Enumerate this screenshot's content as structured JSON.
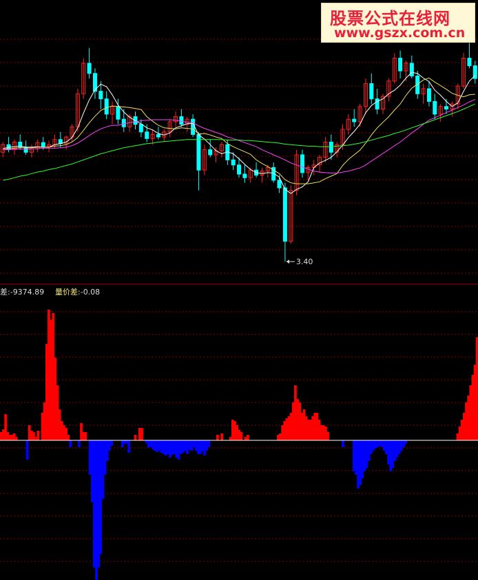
{
  "watermark": {
    "line1": "股票公式在线网",
    "line2": "www.gszx.com.cn"
  },
  "indicator_header": {
    "label1": "差:",
    "value1": "-9374.89",
    "label2": "量价差:",
    "value2": "-0.08"
  },
  "colors": {
    "up": "#ff2020",
    "down": "#00ffff",
    "pos": "#ff0000",
    "neg": "#0000ff",
    "ma5": "#ffffff",
    "ma10": "#f0e060",
    "ma20": "#ff40ff",
    "ma60": "#30ff30",
    "grid": "#8b0000",
    "divider": "#a00000",
    "zero": "#ffffff"
  },
  "chart_data": [
    {
      "type": "candlestick",
      "price_ylim": [
        3.2,
        7.8
      ],
      "low_annotation": "3.40",
      "candles": [
        [
          5.55,
          5.75,
          5.45,
          5.7
        ],
        [
          5.7,
          5.85,
          5.55,
          5.6
        ],
        [
          5.6,
          5.8,
          5.5,
          5.75
        ],
        [
          5.75,
          5.9,
          5.6,
          5.65
        ],
        [
          5.65,
          5.78,
          5.5,
          5.55
        ],
        [
          5.55,
          5.7,
          5.45,
          5.62
        ],
        [
          5.62,
          5.8,
          5.55,
          5.74
        ],
        [
          5.74,
          5.85,
          5.6,
          5.66
        ],
        [
          5.66,
          5.78,
          5.55,
          5.7
        ],
        [
          5.7,
          5.9,
          5.62,
          5.8
        ],
        [
          5.8,
          5.95,
          5.65,
          5.72
        ],
        [
          5.72,
          5.88,
          5.6,
          5.85
        ],
        [
          5.85,
          6.1,
          5.75,
          6.05
        ],
        [
          6.05,
          6.8,
          5.95,
          6.7
        ],
        [
          6.7,
          7.4,
          6.6,
          7.3
        ],
        [
          7.3,
          7.6,
          7.0,
          7.1
        ],
        [
          7.1,
          7.2,
          6.6,
          6.75
        ],
        [
          6.75,
          6.95,
          6.4,
          6.6
        ],
        [
          6.6,
          6.75,
          6.2,
          6.3
        ],
        [
          6.3,
          6.55,
          6.1,
          6.45
        ],
        [
          6.45,
          6.6,
          6.1,
          6.2
        ],
        [
          6.2,
          6.4,
          5.95,
          6.05
        ],
        [
          6.05,
          6.3,
          5.95,
          6.25
        ],
        [
          6.25,
          6.35,
          6.0,
          6.1
        ],
        [
          6.1,
          6.2,
          5.85,
          5.95
        ],
        [
          5.95,
          6.1,
          5.75,
          5.82
        ],
        [
          5.82,
          6.0,
          5.7,
          5.9
        ],
        [
          5.9,
          6.05,
          5.8,
          5.85
        ],
        [
          5.85,
          6.0,
          5.75,
          5.95
        ],
        [
          5.95,
          6.2,
          5.85,
          6.15
        ],
        [
          6.15,
          6.35,
          6.05,
          6.25
        ],
        [
          6.25,
          6.4,
          6.05,
          6.1
        ],
        [
          6.1,
          6.25,
          5.95,
          6.2
        ],
        [
          6.2,
          6.3,
          5.85,
          5.9
        ],
        [
          5.9,
          5.95,
          4.8,
          5.2
        ],
        [
          5.2,
          5.7,
          5.1,
          5.6
        ],
        [
          5.6,
          5.8,
          5.45,
          5.5
        ],
        [
          5.5,
          5.65,
          5.35,
          5.58
        ],
        [
          5.58,
          5.75,
          5.45,
          5.7
        ],
        [
          5.7,
          5.8,
          5.3,
          5.4
        ],
        [
          5.4,
          5.55,
          5.2,
          5.3
        ],
        [
          5.3,
          5.45,
          5.05,
          5.12
        ],
        [
          5.12,
          5.3,
          4.95,
          5.05
        ],
        [
          5.05,
          5.25,
          4.95,
          5.2
        ],
        [
          5.2,
          5.35,
          5.05,
          5.1
        ],
        [
          5.1,
          5.25,
          4.95,
          5.18
        ],
        [
          5.18,
          5.3,
          5.05,
          5.25
        ],
        [
          5.25,
          5.35,
          4.95,
          5.0
        ],
        [
          5.0,
          5.1,
          4.75,
          4.85
        ],
        [
          4.85,
          4.95,
          3.4,
          3.8
        ],
        [
          3.8,
          4.9,
          3.75,
          4.8
        ],
        [
          4.8,
          5.6,
          4.7,
          5.5
        ],
        [
          5.5,
          5.6,
          5.05,
          5.15
        ],
        [
          5.15,
          5.3,
          5.0,
          5.25
        ],
        [
          5.25,
          5.4,
          5.1,
          5.3
        ],
        [
          5.3,
          5.5,
          5.15,
          5.45
        ],
        [
          5.45,
          5.85,
          5.35,
          5.75
        ],
        [
          5.75,
          5.9,
          5.4,
          5.55
        ],
        [
          5.55,
          5.75,
          5.45,
          5.7
        ],
        [
          5.7,
          6.1,
          5.6,
          6.0
        ],
        [
          6.0,
          6.3,
          5.9,
          6.2
        ],
        [
          6.2,
          6.4,
          6.05,
          6.15
        ],
        [
          6.15,
          6.5,
          6.05,
          6.45
        ],
        [
          6.45,
          7.0,
          6.3,
          6.9
        ],
        [
          6.9,
          7.1,
          6.5,
          6.6
        ],
        [
          6.6,
          6.8,
          6.3,
          6.4
        ],
        [
          6.4,
          6.7,
          6.3,
          6.65
        ],
        [
          6.65,
          7.0,
          6.55,
          6.95
        ],
        [
          6.95,
          7.5,
          6.9,
          7.4
        ],
        [
          7.4,
          7.55,
          7.0,
          7.15
        ],
        [
          7.15,
          7.35,
          6.95,
          7.3
        ],
        [
          7.3,
          7.45,
          7.0,
          7.05
        ],
        [
          7.05,
          7.15,
          6.6,
          6.7
        ],
        [
          6.7,
          6.9,
          6.5,
          6.8
        ],
        [
          6.8,
          6.95,
          6.45,
          6.55
        ],
        [
          6.55,
          6.7,
          6.2,
          6.3
        ],
        [
          6.3,
          6.5,
          6.15,
          6.45
        ],
        [
          6.45,
          6.6,
          6.3,
          6.4
        ],
        [
          6.4,
          6.55,
          6.25,
          6.5
        ],
        [
          6.5,
          6.9,
          6.4,
          6.85
        ],
        [
          6.85,
          7.5,
          6.8,
          7.4
        ],
        [
          7.4,
          7.7,
          7.2,
          7.25
        ],
        [
          7.25,
          7.35,
          6.9,
          7.0
        ]
      ],
      "ma5": [
        5.62,
        5.65,
        5.66,
        5.67,
        5.65,
        5.65,
        5.66,
        5.65,
        5.65,
        5.7,
        5.72,
        5.75,
        5.84,
        6.03,
        6.32,
        6.58,
        6.78,
        6.89,
        6.84,
        6.68,
        6.48,
        6.34,
        6.24,
        6.17,
        6.11,
        6.03,
        5.99,
        5.92,
        5.89,
        5.93,
        6.03,
        6.07,
        6.11,
        6.12,
        5.89,
        5.81,
        5.7,
        5.58,
        5.52,
        5.56,
        5.52,
        5.42,
        5.31,
        5.21,
        5.15,
        5.13,
        5.15,
        5.14,
        5.06,
        4.82,
        4.74,
        4.82,
        4.87,
        4.97,
        5.25,
        5.34,
        5.39,
        5.45,
        5.56,
        5.69,
        5.84,
        5.96,
        6.1,
        6.33,
        6.47,
        6.55,
        6.6,
        6.7,
        6.77,
        6.87,
        7.01,
        7.12,
        7.1,
        7.01,
        6.94,
        6.77,
        6.67,
        6.55,
        6.45,
        6.52,
        6.75,
        6.95,
        7.06
      ],
      "ma10": [
        5.6,
        5.62,
        5.63,
        5.64,
        5.64,
        5.64,
        5.65,
        5.65,
        5.65,
        5.67,
        5.68,
        5.7,
        5.75,
        5.84,
        5.98,
        6.13,
        6.26,
        6.37,
        6.43,
        6.46,
        6.45,
        6.44,
        6.43,
        6.41,
        6.39,
        6.25,
        6.16,
        6.08,
        6.03,
        6.02,
        6.01,
        6.03,
        6.02,
        6.01,
        5.91,
        5.92,
        5.89,
        5.85,
        5.82,
        5.72,
        5.66,
        5.61,
        5.56,
        5.51,
        5.4,
        5.33,
        5.27,
        5.2,
        5.13,
        5.01,
        4.95,
        4.93,
        4.93,
        4.93,
        4.95,
        4.97,
        5.03,
        5.08,
        5.13,
        5.29,
        5.41,
        5.5,
        5.59,
        5.73,
        5.89,
        6.03,
        6.14,
        6.25,
        6.38,
        6.5,
        6.67,
        6.81,
        6.89,
        6.97,
        7.01,
        6.93,
        6.86,
        6.79,
        6.71,
        6.67,
        6.64,
        6.68,
        6.69
      ],
      "ma20": [
        5.6,
        5.6,
        5.61,
        5.61,
        5.61,
        5.62,
        5.62,
        5.63,
        5.63,
        5.63,
        5.64,
        5.65,
        5.68,
        5.73,
        5.8,
        5.88,
        5.95,
        6.01,
        6.05,
        6.08,
        6.08,
        6.11,
        6.13,
        6.15,
        6.17,
        6.18,
        6.19,
        6.19,
        6.19,
        6.19,
        6.18,
        6.16,
        6.14,
        6.13,
        6.07,
        6.02,
        5.98,
        5.94,
        5.9,
        5.85,
        5.82,
        5.78,
        5.74,
        5.7,
        5.66,
        5.6,
        5.55,
        5.5,
        5.45,
        5.4,
        5.34,
        5.3,
        5.26,
        5.22,
        5.18,
        5.16,
        5.15,
        5.14,
        5.14,
        5.16,
        5.18,
        5.21,
        5.24,
        5.3,
        5.38,
        5.45,
        5.53,
        5.6,
        5.68,
        5.75,
        5.84,
        5.93,
        6.01,
        6.1,
        6.18,
        6.23,
        6.28,
        6.33,
        6.38,
        6.43,
        6.48,
        6.54,
        6.59
      ],
      "ma60": [
        5.0,
        5.02,
        5.05,
        5.08,
        5.1,
        5.13,
        5.16,
        5.18,
        5.21,
        5.23,
        5.26,
        5.29,
        5.32,
        5.36,
        5.4,
        5.44,
        5.48,
        5.52,
        5.55,
        5.58,
        5.61,
        5.64,
        5.66,
        5.68,
        5.7,
        5.72,
        5.73,
        5.75,
        5.76,
        5.77,
        5.78,
        5.79,
        5.8,
        5.8,
        5.8,
        5.8,
        5.8,
        5.8,
        5.8,
        5.79,
        5.79,
        5.79,
        5.78,
        5.78,
        5.77,
        5.76,
        5.75,
        5.74,
        5.73,
        5.71,
        5.7,
        5.69,
        5.68,
        5.67,
        5.67,
        5.66,
        5.66,
        5.66,
        5.67,
        5.68,
        5.69,
        5.71,
        5.73,
        5.76,
        5.79,
        5.82,
        5.85,
        5.88,
        5.92,
        5.95,
        5.99,
        6.03,
        6.07,
        6.11,
        6.15,
        6.19,
        6.23,
        6.27,
        6.31,
        6.35,
        6.4,
        6.45,
        6.5
      ]
    },
    {
      "type": "bar",
      "ylim": [
        -210,
        210
      ],
      "values": [
        12,
        16,
        38,
        12,
        8,
        8,
        10,
        5,
        0,
        0,
        0,
        0,
        -28,
        22,
        14,
        12,
        5,
        14,
        0,
        40,
        55,
        140,
        190,
        175,
        185,
        120,
        80,
        45,
        28,
        22,
        18,
        8,
        -10,
        0,
        0,
        0,
        -10,
        25,
        12,
        12,
        0,
        -50,
        -90,
        -185,
        -210,
        -185,
        -165,
        -85,
        -50,
        -30,
        -15,
        -8,
        0,
        0,
        0,
        0,
        -10,
        -5,
        -5,
        -18,
        0,
        0,
        8,
        0,
        18,
        18,
        0,
        -4,
        -10,
        -10,
        -13,
        -15,
        -17,
        -15,
        -18,
        -20,
        -22,
        -20,
        -25,
        -21,
        -20,
        -25,
        -28,
        -20,
        -18,
        -15,
        -20,
        -14,
        -15,
        -10,
        -15,
        -20,
        -20,
        -16,
        -22,
        -15,
        -10,
        0,
        0,
        0,
        8,
        0,
        10,
        0,
        0,
        0,
        5,
        30,
        28,
        22,
        15,
        12,
        0,
        5,
        8,
        0,
        0,
        0,
        0,
        0,
        0,
        0,
        0,
        0,
        0,
        0,
        0,
        0,
        8,
        10,
        22,
        28,
        32,
        35,
        40,
        55,
        80,
        60,
        55,
        40,
        45,
        35,
        30,
        30,
        35,
        40,
        40,
        30,
        22,
        22,
        20,
        12,
        0,
        0,
        0,
        0,
        0,
        0,
        -10,
        0,
        0,
        0,
        0,
        -45,
        -50,
        -70,
        -65,
        -55,
        -45,
        -40,
        -30,
        -20,
        -15,
        -12,
        -10,
        -8,
        -10,
        -15,
        -20,
        -35,
        -45,
        -40,
        -30,
        -25,
        -20,
        -15,
        -10,
        -5,
        0,
        0,
        0,
        0,
        0,
        0,
        0,
        0,
        0,
        0,
        0,
        0,
        0,
        0,
        0,
        0,
        0,
        0,
        0,
        0,
        0,
        0,
        0,
        10,
        20,
        30,
        40,
        55,
        65,
        80,
        95,
        110,
        150
      ]
    }
  ]
}
